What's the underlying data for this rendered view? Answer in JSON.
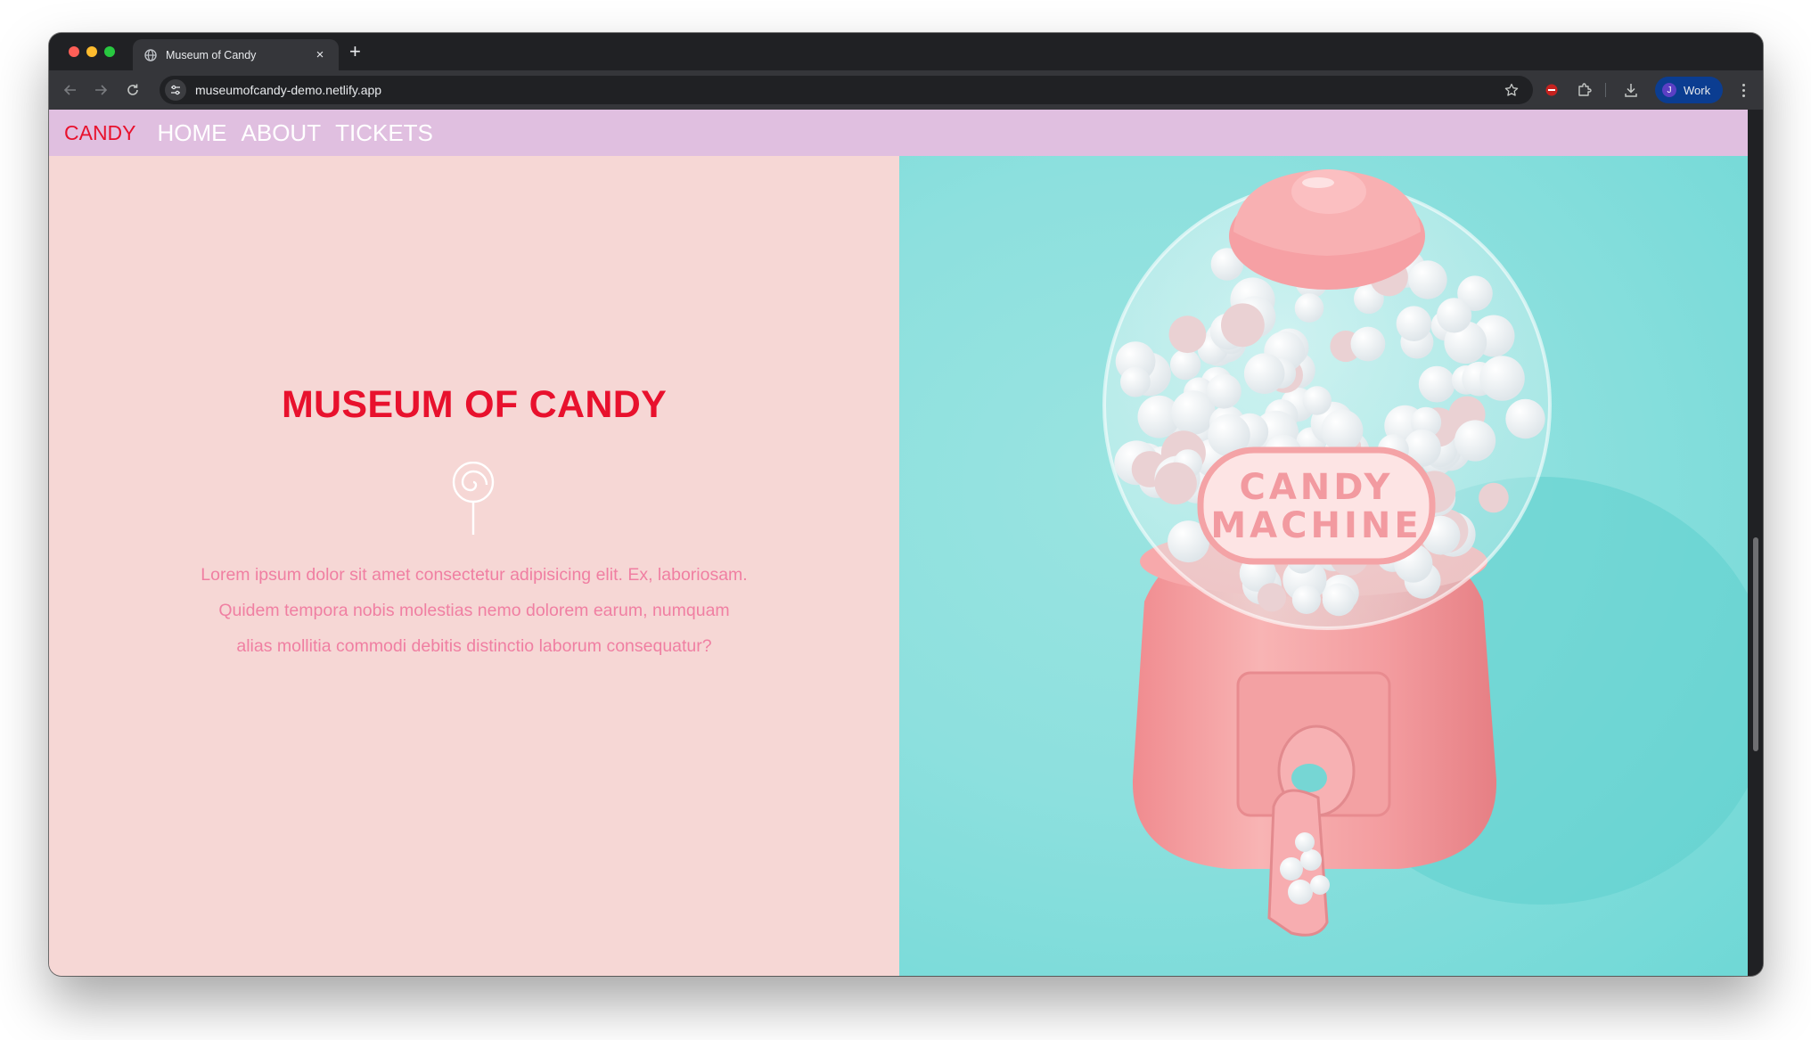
{
  "browser": {
    "tab": {
      "title": "Museum of Candy"
    },
    "url": "museumofcandy-demo.netlify.app",
    "profile": {
      "initial": "J",
      "label": "Work"
    }
  },
  "site": {
    "brand": "CANDY",
    "nav": [
      "HOME",
      "ABOUT",
      "TICKETS"
    ],
    "hero": {
      "title": "MUSEUM OF CANDY",
      "body": "Lorem ipsum dolor sit amet consectetur adipisicing elit. Ex, laboriosam. Quidem tempora nobis molestias nemo dolorem earum, numquam alias mollitia commodi debitis distinctio laborum consequatur?"
    },
    "image_sign": [
      "CANDY",
      "MACHINE"
    ]
  },
  "colors": {
    "brand": "#e8112d",
    "nav_bg": "#e0bfe0",
    "page_bg": "#f6d7d5",
    "body_text": "#f07fa2",
    "image_bg": "#8de0de",
    "machine_pink": "#f4a6a8"
  },
  "icons": {
    "favicon": "globe-icon",
    "lollipop": "lollipop-icon",
    "bookmark": "star-icon",
    "extensions": "puzzle-icon",
    "download": "download-icon"
  }
}
